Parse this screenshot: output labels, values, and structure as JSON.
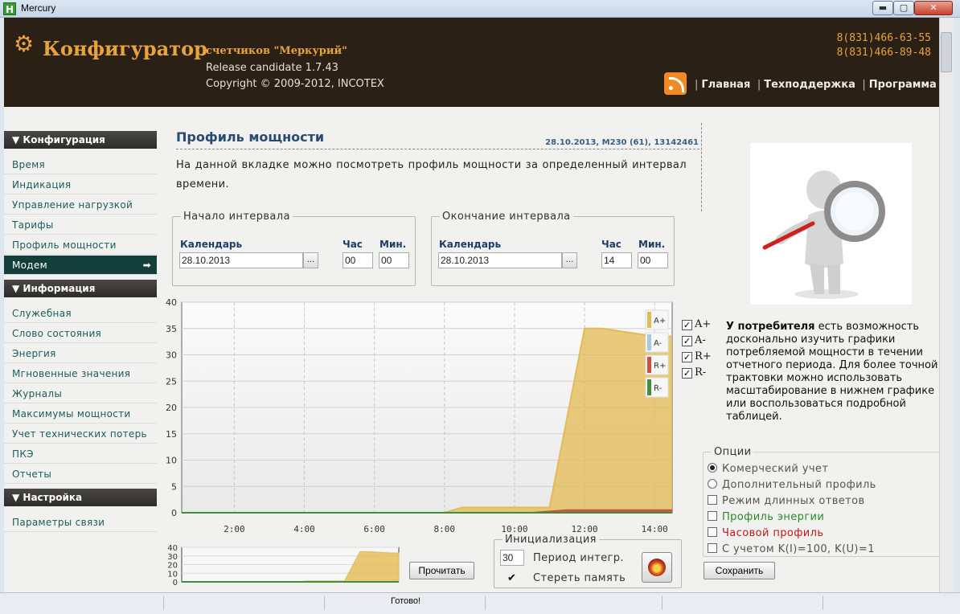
{
  "window": {
    "app_icon": "H",
    "title": "Mercury",
    "min": "▬",
    "max": "▢",
    "close": "✕"
  },
  "header": {
    "logo_icon": "gear-icon",
    "title": "Конфигуратор",
    "subtitle": "счетчиков \"Меркурий\"",
    "release": "Release candidate 1.7.43",
    "copyright": "Copyright © 2009-2012, INCOTEX",
    "phones": [
      "8(831)466-63-55",
      "8(831)466-89-48"
    ],
    "nav": [
      "Главная",
      "Техподдержка",
      "Программа"
    ]
  },
  "sidebar": {
    "sections": [
      {
        "title": "▼ Конфигурация",
        "items": [
          "Время",
          "Индикация",
          "Управление нагрузкой",
          "Тарифы",
          "Профиль мощности",
          "Модем"
        ]
      },
      {
        "title": "▼ Информация",
        "items": [
          "Служебная",
          "Слово состояния",
          "Энергия",
          "Мгновенные значения",
          "Журналы",
          "Максимумы мощности",
          "Учет технических потерь",
          "ПКЭ",
          "Отчеты"
        ]
      },
      {
        "title": "▼ Настройка",
        "items": [
          "Параметры связи"
        ]
      }
    ],
    "active_item": "Модем"
  },
  "main": {
    "title": "Профиль мощности",
    "meta": "28.10.2013, M230 (61), 13142461",
    "intro": "На данной вкладке можно посмотреть профиль мощности за определенный интервал времени.",
    "start": {
      "legend": "Начало интервала",
      "cal_label": "Календарь",
      "date": "28.10.2013",
      "hour_label": "Час",
      "min_label": "Мин.",
      "hour": "00",
      "min": "00",
      "dots": "..."
    },
    "end": {
      "legend": "Окончание интервала",
      "cal_label": "Календарь",
      "date": "28.10.2013",
      "hour_label": "Час",
      "min_label": "Мин.",
      "hour": "14",
      "min": "00",
      "dots": "..."
    }
  },
  "chart_data": [
    {
      "type": "area",
      "x_ticks": [
        "2:00",
        "4:00",
        "6:00",
        "8:00",
        "10:00",
        "12:00",
        "14:00"
      ],
      "y_ticks": [
        0,
        5,
        10,
        15,
        20,
        25,
        30,
        35,
        40
      ],
      "xlim": [
        0.5,
        14.5
      ],
      "ylim": [
        0,
        40
      ],
      "grid": true,
      "legend": "top-right",
      "legend_labels": [
        "A+",
        "A-",
        "R+",
        "R-"
      ],
      "colors": {
        "A+": "#e3bb54",
        "A-": "#a9c6e3",
        "R+": "#c9533a",
        "R-": "#3f8f3f"
      },
      "series": [
        {
          "name": "A+",
          "x": [
            0.5,
            8.0,
            8.5,
            10.5,
            11.0,
            11.5,
            12.0,
            12.5,
            13.0,
            13.5,
            14.0,
            14.5
          ],
          "values": [
            0,
            0,
            1,
            1,
            1,
            18,
            35,
            35,
            34.5,
            34,
            33.5,
            33.5
          ]
        },
        {
          "name": "R+",
          "x": [
            0.5,
            10.5,
            11.5,
            14.5
          ],
          "values": [
            0,
            0,
            0.5,
            0.5
          ]
        },
        {
          "name": "R-",
          "x": [
            0.5,
            14.5
          ],
          "values": [
            0,
            0
          ]
        }
      ]
    },
    {
      "type": "area",
      "y_ticks": [
        0,
        10,
        20,
        30,
        40
      ],
      "xlim": [
        0.5,
        14.5
      ],
      "ylim": [
        0,
        40
      ],
      "series": [
        {
          "name": "A+",
          "x": [
            0.5,
            8.0,
            8.5,
            10.5,
            11.0,
            11.5,
            12.0,
            12.5,
            13.0,
            13.5,
            14.0,
            14.5
          ],
          "values": [
            0,
            0,
            1,
            1,
            1,
            18,
            35,
            35,
            34.5,
            34,
            33.5,
            33.5
          ]
        }
      ]
    }
  ],
  "series_toggles": [
    {
      "label": "A+",
      "checked": true
    },
    {
      "label": "A-",
      "checked": true
    },
    {
      "label": "R+",
      "checked": true
    },
    {
      "label": "R-",
      "checked": true
    }
  ],
  "read_button": "Прочитать",
  "init": {
    "legend": "Инициализация",
    "period_value": "30",
    "period_label": "Период интегр.",
    "erase_label": "Стереть память",
    "erase_checked": true,
    "run_icon": "flame-icon"
  },
  "right": {
    "figure_icon": "magnifier-figure-icon",
    "text_bold": "У потребителя",
    "text_rest": " есть возможность досконально изучить графики потребляемой мощности в течении отчетного периода. Для более точной трактовки можно использовать масштабирование в нижнем графике или воспользоваться подробной таблицей.",
    "options_legend": "Опции",
    "options": [
      {
        "label": "Комерческий учет",
        "kind": "radio",
        "checked": true,
        "color": "#555555"
      },
      {
        "label": "Дополнительный профиль",
        "kind": "radio",
        "checked": false,
        "color": "#555555"
      },
      {
        "label": "Режим длинных ответов",
        "kind": "check",
        "checked": false,
        "color": "#555555"
      },
      {
        "label": "Профиль энергии",
        "kind": "check",
        "checked": false,
        "color": "#2a8a2a"
      },
      {
        "label": "Часовой профиль",
        "kind": "check",
        "checked": false,
        "color": "#c01818"
      },
      {
        "label": "С учетом K(I)=100, K(U)=1",
        "kind": "check",
        "checked": false,
        "color": "#555555"
      }
    ],
    "save_button": "Сохранить"
  },
  "status": {
    "text": "Готово!"
  }
}
